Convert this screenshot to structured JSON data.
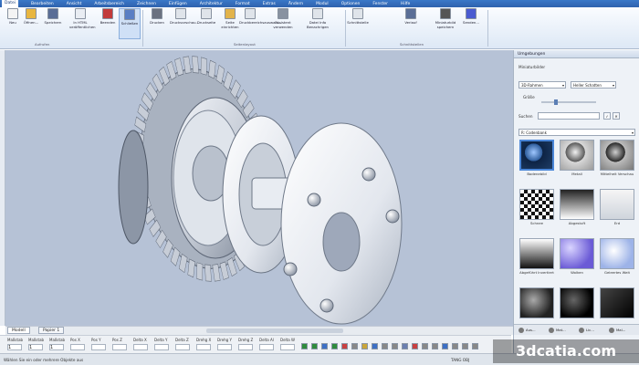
{
  "menu": [
    "Datei",
    "Bearbeiten",
    "Ansicht",
    "Arbeitsbereich",
    "Zeichnen",
    "Einfügen",
    "Architektur",
    "Format",
    "Extras",
    "Ändern",
    "Modul",
    "Optionen",
    "Fenster",
    "Hilfe"
  ],
  "ribbon": {
    "buttons": [
      {
        "label": "Neu",
        "icon": "new-file-icon",
        "color": "#f4f4f4"
      },
      {
        "label": "Öffnen...",
        "icon": "open-folder-icon",
        "color": "#e8b640"
      },
      {
        "label": "Speichern",
        "icon": "save-icon",
        "color": "#5a6e96"
      },
      {
        "label": "In HTML veröffentlichen",
        "icon": "publish-html-icon",
        "color": "#e9edf3"
      },
      {
        "label": "Beenden",
        "icon": "exit-icon",
        "color": "#c23b3b"
      },
      {
        "label": "Schließen",
        "icon": "close-document-icon",
        "color": "#5a7fc4"
      },
      {
        "label": "Drucken",
        "icon": "print-icon",
        "color": "#6b7280"
      },
      {
        "label": "Druckvorschau...",
        "icon": "print-preview-icon",
        "color": "#dfe4ea"
      },
      {
        "label": "Druckseite",
        "icon": "page-setup-icon",
        "color": "#dfe4ea"
      },
      {
        "label": "Seite einrichten",
        "icon": "page-layout-icon",
        "color": "#e2b34a"
      },
      {
        "label": "Druckbereichsauswahl...",
        "icon": "print-area-icon",
        "color": "#dfe4ea"
      },
      {
        "label": "Assistent verwenden",
        "icon": "wizard-icon",
        "color": "#8892a0"
      },
      {
        "label": "Datei Info Benachrigen",
        "icon": "file-info-icon",
        "color": "#dfe4ea"
      },
      {
        "label": "Schnittstelle",
        "icon": "interface-icon",
        "color": "#dfe4ea"
      },
      {
        "label": "Verlauf",
        "icon": "export-icon",
        "color": "#5a6e96"
      },
      {
        "label": "Miniaturbild speichern",
        "icon": "more-icon",
        "color": "#555"
      },
      {
        "label": "Senden...",
        "icon": "send-icon",
        "color": "#4a5bd0"
      }
    ],
    "groups": [
      "Aufrufen",
      "Seitenlayout",
      "Schnittstellen"
    ]
  },
  "view_tabs": [
    "Modell",
    "Papier 1"
  ],
  "coords": {
    "labels": [
      "Maßstab",
      "Maßstab",
      "Maßstab",
      "Pos X",
      "Pos Y",
      "Pos Z",
      "Delta X",
      "Delta Y",
      "Delta Z",
      "Drehg X",
      "Drehg Y",
      "Drehg Z",
      "Delta Al",
      "Delta W"
    ],
    "values": [
      "1",
      "1",
      "1",
      "",
      "",
      "",
      "",
      "",
      "",
      "",
      "",
      "",
      "",
      ""
    ]
  },
  "status": {
    "hint": "Wählen Sie ein oder mehrere Objekte aus",
    "right": "TANG OBJ"
  },
  "panel": {
    "title": "Umgebungen",
    "thumbnail_label": "Miniaturbilder",
    "frame_select": "3D-Rahmen",
    "shading_select": "Heller Schatten",
    "size_label": "Größe",
    "search_label": "Suchen",
    "category_select": "R: Codenbank",
    "materials": [
      {
        "name": "Bodenebild",
        "style": "sphere-blue-tile",
        "selected": true
      },
      {
        "name": "Metall",
        "style": "sphere-metal-check"
      },
      {
        "name": "Mittelheit Verschau",
        "style": "sphere-dark-check"
      },
      {
        "name": "Schnee",
        "style": "sphere-checker"
      },
      {
        "name": "Abgestuft",
        "style": "gradient-gray"
      },
      {
        "name": "Erd",
        "style": "white-fade"
      },
      {
        "name": "Abgeführt Invertiert",
        "style": "gradient-dark"
      },
      {
        "name": "Wolken",
        "style": "purple-clouds"
      },
      {
        "name": "Geleertes Weit",
        "style": "blue-sheen"
      },
      {
        "name": "",
        "style": "dark-metal"
      },
      {
        "name": "",
        "style": "dark-sphere"
      },
      {
        "name": "",
        "style": "black-bevel"
      }
    ],
    "footer_tabs": [
      "Aus...",
      "Mat...",
      "Lic...",
      "Mal..."
    ]
  },
  "watermark": "3dcatia.com",
  "colors": {
    "menubar": "#3a78c8",
    "viewport": "#b6c2d6",
    "selection": "#4a86d8"
  }
}
